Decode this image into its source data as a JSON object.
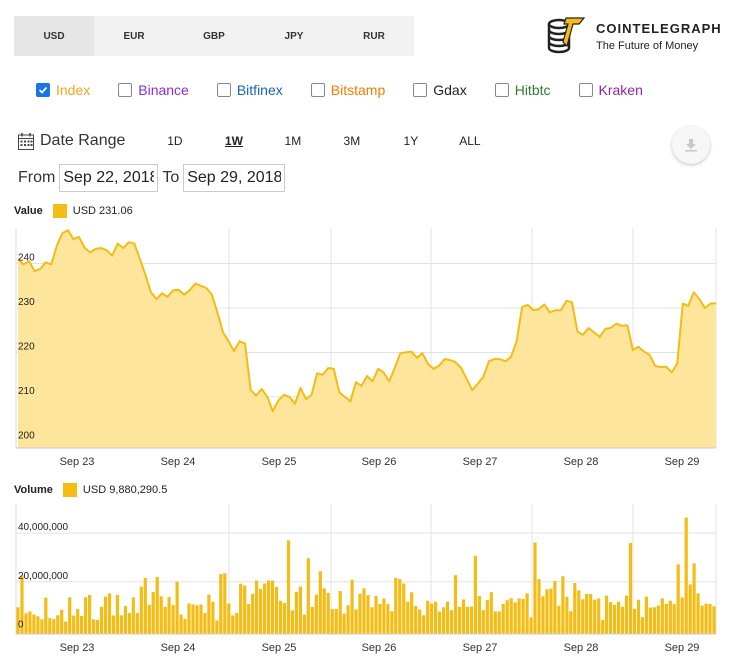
{
  "currencies": [
    "USD",
    "EUR",
    "GBP",
    "JPY",
    "RUR"
  ],
  "selected_currency": "USD",
  "logo": {
    "name": "COINTELEGRAPH",
    "tagline": "The Future of Money"
  },
  "exchanges": [
    {
      "label": "Index",
      "checked": true,
      "color": "#f5a623"
    },
    {
      "label": "Binance",
      "checked": false,
      "color": "#8a2be2"
    },
    {
      "label": "Bitfinex",
      "checked": false,
      "color": "#1565c0"
    },
    {
      "label": "Bitstamp",
      "checked": false,
      "color": "#f57c00"
    },
    {
      "label": "Gdax",
      "checked": false,
      "color": "#222222"
    },
    {
      "label": "Hitbtc",
      "checked": false,
      "color": "#2e7d32"
    },
    {
      "label": "Kraken",
      "checked": false,
      "color": "#8e24aa"
    }
  ],
  "date_range": {
    "title": "Date Range",
    "buttons": [
      "1D",
      "1W",
      "1M",
      "3M",
      "1Y",
      "ALL"
    ],
    "active": "1W",
    "from_label": "From",
    "to_label": "To",
    "from": "Sep 22, 2018",
    "to": "Sep 29, 2018"
  },
  "chart_data": [
    {
      "type": "area",
      "title": "Value",
      "legend": {
        "name": "USD",
        "value": "231.06"
      },
      "color": "#f5bc14",
      "fill": "#fde59b",
      "ylim": [
        198.5,
        248
      ],
      "yticks": [
        200,
        210,
        220,
        230,
        240
      ],
      "x_labels": [
        "Sep 23",
        "Sep 24",
        "Sep 25",
        "Sep 26",
        "Sep 27",
        "Sep 28",
        "Sep 29"
      ],
      "x_start": "Sep 22 15:00",
      "x_end": "Sep 29 16:00",
      "values": [
        241,
        239.8,
        240.5,
        238.3,
        238.8,
        240.3,
        239.8,
        244,
        246.8,
        247.5,
        245.5,
        246,
        243.6,
        242.5,
        243.3,
        243.5,
        243,
        241.8,
        244.5,
        243.5,
        244.8,
        244.5,
        241,
        237.5,
        233.5,
        232,
        233.3,
        232.5,
        234,
        234.1,
        233,
        234,
        235.5,
        235,
        234.5,
        233,
        229,
        224.5,
        222.5,
        220.3,
        222.5,
        222,
        211.5,
        210.3,
        211.8,
        210,
        206.8,
        209.2,
        210.5,
        210,
        208.5,
        212,
        209.5,
        210.5,
        215.3,
        215,
        216.5,
        216.3,
        211,
        210,
        209,
        213.3,
        212.5,
        214.7,
        213.5,
        216.3,
        215.5,
        213.5,
        216.5,
        219.8,
        220,
        220.2,
        218.8,
        219.8,
        217.5,
        216.3,
        217,
        218.5,
        218.3,
        217.8,
        216.5,
        214,
        211.5,
        213,
        214.5,
        218,
        218.5,
        218.5,
        218,
        219,
        222.5,
        230.2,
        230.7,
        229.5,
        229.7,
        230.8,
        229,
        229.5,
        229.5,
        231.6,
        231.3,
        224.7,
        224,
        225.5,
        224.5,
        223.5,
        225.3,
        225.5,
        226.5,
        226,
        226.1,
        220.5,
        221.3,
        220.2,
        219.5,
        217,
        216.7,
        216.8,
        215.5,
        217.5,
        231,
        230.5,
        233.5,
        232,
        230,
        231,
        231.06
      ]
    },
    {
      "type": "bar",
      "title": "Volume",
      "legend": {
        "name": "USD",
        "value": "9,880,290.5"
      },
      "color": "#f5bc14",
      "ylim": [
        -1500000,
        52000000
      ],
      "yticks": [
        0,
        20000000,
        40000000
      ],
      "ytick_labels": [
        "0",
        "20,000,000",
        "40,000,000"
      ],
      "x_labels": [
        "Sep 23",
        "Sep 24",
        "Sep 25",
        "Sep 26",
        "Sep 27",
        "Sep 28",
        "Sep 29"
      ],
      "values": [
        9500000,
        22500000,
        7000000,
        7800000,
        6500000,
        5800000,
        4500000,
        13500000,
        5000000,
        4600000,
        6200000,
        8500000,
        3600000,
        13600000,
        6100000,
        8800000,
        5900000,
        13600000,
        14600000,
        4500000,
        4300000,
        9700000,
        13900000,
        15200000,
        6100000,
        14600000,
        6200000,
        10000000,
        7100000,
        13600000,
        7100000,
        18000000,
        21600000,
        10500000,
        15800000,
        22000000,
        14000000,
        9700000,
        13700000,
        10400000,
        20000000,
        6500000,
        4700000,
        11100000,
        10700000,
        10300000,
        10600000,
        7100000,
        14700000,
        11800000,
        4100000,
        23200000,
        23500000,
        11100000,
        6100000,
        7200000,
        19200000,
        18400000,
        10900000,
        15000000,
        20500000,
        17000000,
        19300000,
        20500000,
        20500000,
        17900000,
        12200000,
        11300000,
        37000000,
        8200000,
        15800000,
        18000000,
        6500000,
        29700000,
        9600000,
        14700000,
        24300000,
        17300000,
        15400000,
        8700000,
        8800000,
        16200000,
        6900000,
        10300000,
        20800000,
        8600000,
        15100000,
        17300000,
        14500000,
        9500000,
        14200000,
        10900000,
        13100000,
        10900000,
        7900000,
        21600000,
        21100000,
        19300000,
        11800000,
        15700000,
        10000000,
        8600000,
        6200000,
        12200000,
        11000000,
        11800000,
        7700000,
        9500000,
        11800000,
        8300000,
        22700000,
        9700000,
        12700000,
        9700000,
        9800000,
        30700000,
        14100000,
        8300000,
        12500000,
        15700000,
        7800000,
        7800000,
        10900000,
        12400000,
        13200000,
        11500000,
        13200000,
        12900000,
        15200000,
        5300000,
        36200000,
        21100000,
        14000000,
        16900000,
        17200000,
        20300000,
        10100000,
        22300000,
        13800000,
        7900000,
        19500000,
        16500000,
        12800000,
        15000000,
        14900000,
        12600000,
        13100000,
        4300000,
        14300000,
        11600000,
        10500000,
        11800000,
        9700000,
        14300000,
        36000000,
        8800000,
        12600000,
        5400000,
        13900000,
        9400000,
        9500000,
        10200000,
        13200000,
        10900000,
        12200000,
        10800000,
        27200000,
        13500000,
        46400000,
        18900000,
        27600000,
        15200000,
        10200000,
        11000000,
        10900000,
        9880290.5
      ]
    }
  ]
}
